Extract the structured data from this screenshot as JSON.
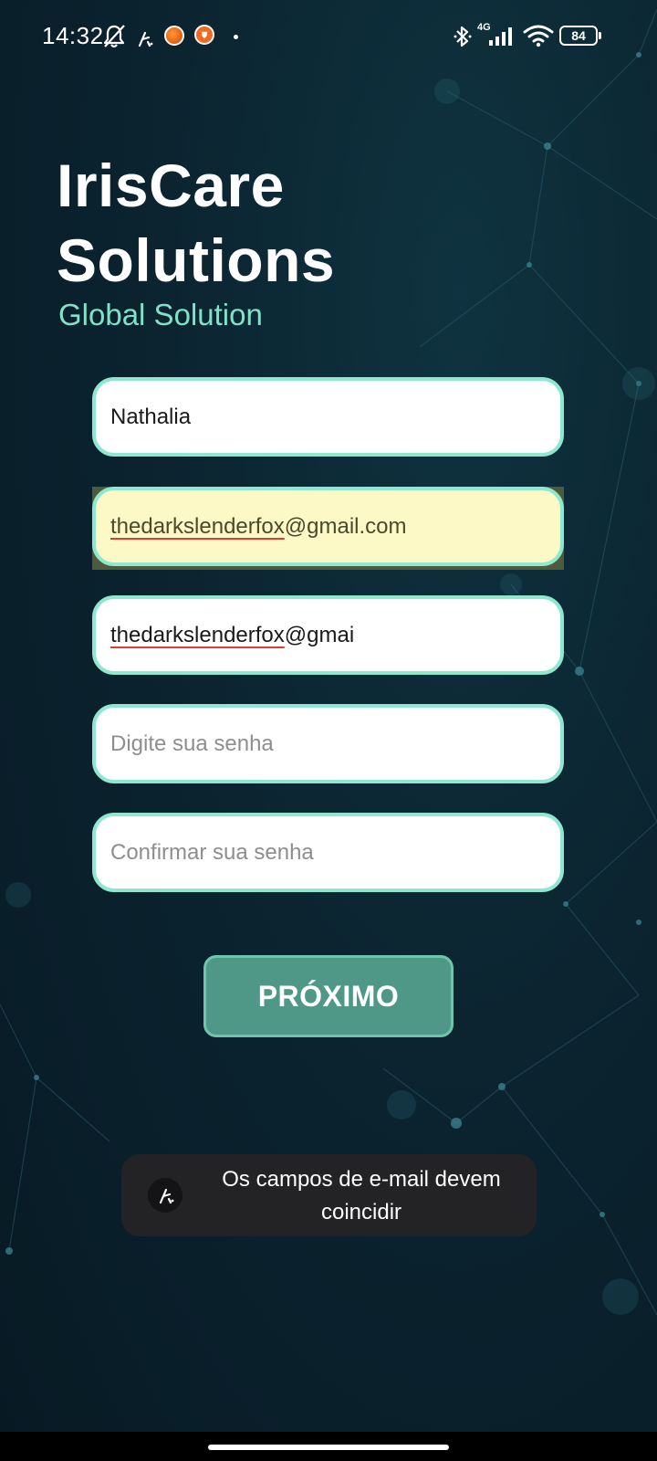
{
  "status_bar": {
    "time": "14:32",
    "network_type": "4G",
    "battery": "84",
    "icons": [
      "bell-off-icon",
      "app-k-icon",
      "orange-app-icon",
      "brave-icon",
      "more-dot-icon",
      "bluetooth-icon",
      "signal-icon",
      "wifi-icon",
      "battery-icon"
    ]
  },
  "header": {
    "title_line1": "IrisCare",
    "title_line2": "Solutions",
    "subtitle": "Global Solution"
  },
  "form": {
    "name": {
      "value": "Nathalia",
      "placeholder": ""
    },
    "email": {
      "value_underlined": "thedarkslenderfox",
      "value_rest": "@gmail.com",
      "autofilled": true
    },
    "confirm_email": {
      "value_underlined": "thedarkslenderfox",
      "value_rest": "@gmai"
    },
    "password": {
      "placeholder": "Digite sua senha"
    },
    "confirm_password": {
      "placeholder": "Confirmar sua senha"
    },
    "next_label": "PRÓXIMO"
  },
  "toast": {
    "line1": "Os campos de e-mail devem",
    "line2": "coincidir",
    "icon": "app-k-icon"
  },
  "colors": {
    "background": "#0b2430",
    "accent": "#8ee7cf",
    "subtitle": "#7fe3c7",
    "button": "#4f9887",
    "autofill": "#fcf9c6",
    "spellcheck": "#e53935"
  }
}
